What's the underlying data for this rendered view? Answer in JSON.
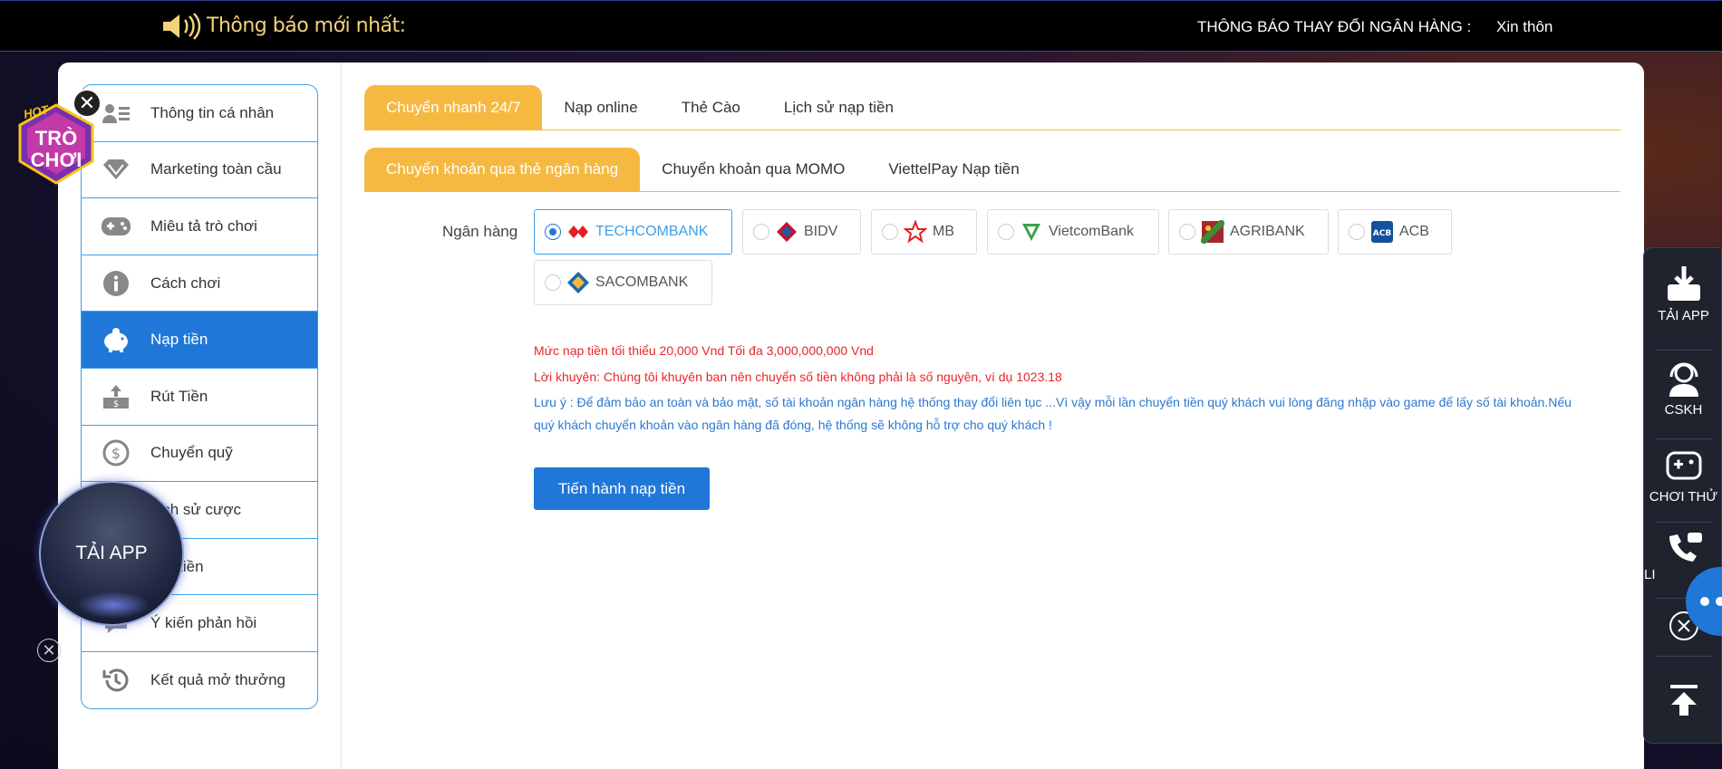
{
  "topbar": {
    "notice_title": "Thông báo mới nhất:",
    "marquee_label": "THÔNG BÁO THAY ĐỔI NGÂN HÀNG :",
    "marquee_text": "Xin thôn"
  },
  "sidebar": {
    "items": [
      {
        "label": "Thông tin cá nhân",
        "icon": "profile-card-icon"
      },
      {
        "label": "Marketing toàn cầu",
        "icon": "diamond-icon"
      },
      {
        "label": "Miêu tả trò chơi",
        "icon": "gamepad-icon"
      },
      {
        "label": "Cách chơi",
        "icon": "info-icon"
      },
      {
        "label": "Nạp tiền",
        "icon": "piggy-bank-icon",
        "active": true
      },
      {
        "label": "Rút Tiền",
        "icon": "withdraw-icon"
      },
      {
        "label": "Chuyển quỹ",
        "icon": "transfer-money-icon"
      },
      {
        "label": "Lịch sử cược",
        "icon": "bet-history-icon"
      },
      {
        "label": "Rút tiền",
        "icon": "cash-icon"
      },
      {
        "label": "Ý kiến phản hồi",
        "icon": "feedback-icon"
      },
      {
        "label": "Kết quả mở thưởng",
        "icon": "history-clock-icon"
      }
    ]
  },
  "tabs_primary": [
    "Chuyển nhanh 24/7",
    "Nạp online",
    "Thẻ Cào",
    "Lịch sử nạp tiền"
  ],
  "tabs_secondary": [
    "Chuyển khoản qua thẻ ngân hàng",
    "Chuyển khoản qua MOMO",
    "ViettelPay Nạp tiền"
  ],
  "bank_label": "Ngân hàng",
  "banks": [
    {
      "name": "TECHCOMBANK",
      "selected": true
    },
    {
      "name": "BIDV"
    },
    {
      "name": "MB"
    },
    {
      "name": "VietcomBank"
    },
    {
      "name": "AGRIBANK"
    },
    {
      "name": "ACB"
    },
    {
      "name": "SACOMBANK"
    }
  ],
  "messages": {
    "limit": "Mức nạp tiền tối thiểu 20,000 Vnd Tối đa 3,000,000,000 Vnd",
    "advice": "Lời khuyên: Chúng tôi khuyên ban nên chuyển số tiền không phải là số nguyên, ví dụ 1023.18",
    "note": "Lưu ý : Để đảm bảo an toàn và bảo mật, số tài khoản ngân hàng hệ thống thay đổi liên tục ...Vì vậy mỗi lần chuyển tiền quý khách vui lòng đăng nhập vào game để lấy số tài khoản.Nếu quý khách chuyển khoản vào ngân hàng đã đóng, hệ thống sẽ không hỗ trợ cho quý khách !"
  },
  "submit_label": "Tiến hành nạp tiền",
  "hot_badge": {
    "line1": "HOT",
    "line2": "TRÒ",
    "line3": "CHƠI"
  },
  "taiapp_ball": "TẢI APP",
  "right_panel": {
    "download": "TẢI APP",
    "support": "CSKH",
    "trial": "CHƠI THỬ",
    "contact": "LI"
  },
  "colors": {
    "accent_orange": "#f5b942",
    "primary_blue": "#1f78d8",
    "alert_red": "#e8262a"
  }
}
